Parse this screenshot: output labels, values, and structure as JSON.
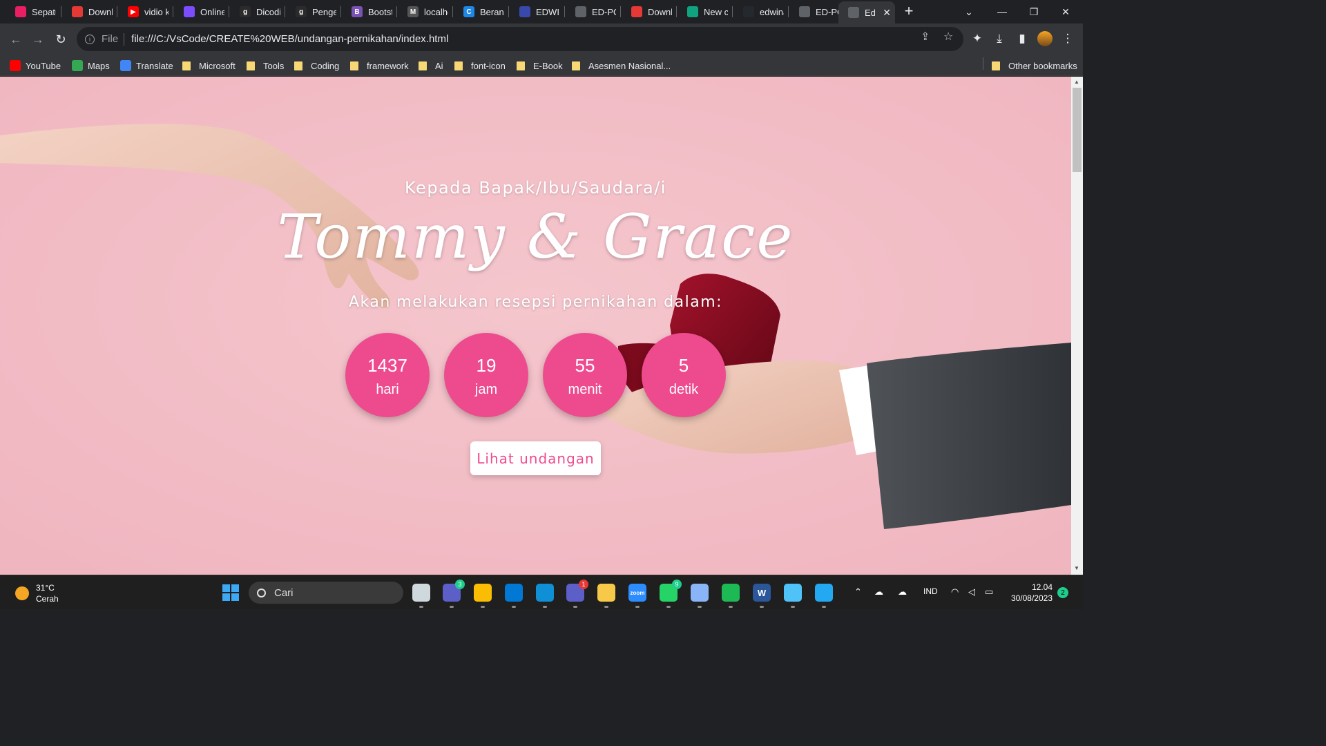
{
  "browser": {
    "tabs": [
      {
        "title": "Sepatu",
        "color": "#e91e63",
        "glyph": ""
      },
      {
        "title": "Downlo",
        "color": "#e53935",
        "glyph": ""
      },
      {
        "title": "vidio kl",
        "color": "#ff0000",
        "glyph": "▶"
      },
      {
        "title": "Online",
        "color": "#7c4dff",
        "glyph": ""
      },
      {
        "title": "Dicodin",
        "color": "#2b2b2b",
        "glyph": "g"
      },
      {
        "title": "Pengen",
        "color": "#2b2b2b",
        "glyph": "g"
      },
      {
        "title": "Bootstr",
        "color": "#7952b3",
        "glyph": "B"
      },
      {
        "title": "localho",
        "color": "#555555",
        "glyph": "M"
      },
      {
        "title": "Berand",
        "color": "#1e88e5",
        "glyph": "C"
      },
      {
        "title": "EDWIN",
        "color": "#3949ab",
        "glyph": ""
      },
      {
        "title": "ED-PO",
        "color": "#5f6368",
        "glyph": ""
      },
      {
        "title": "Downlo",
        "color": "#e53935",
        "glyph": ""
      },
      {
        "title": "New ch",
        "color": "#10a37f",
        "glyph": ""
      },
      {
        "title": "edwina",
        "color": "#24292e",
        "glyph": ""
      },
      {
        "title": "ED-PO",
        "color": "#5f6368",
        "glyph": ""
      },
      {
        "title": "Edw",
        "color": "#5f6368",
        "glyph": "",
        "active": true
      }
    ],
    "new_tab_label": "+",
    "url_scheme": "File",
    "url": "file:///C:/VsCode/CREATE%20WEB/undangan-pernikahan/index.html",
    "bookmarks": [
      {
        "label": "YouTube",
        "type": "site",
        "color": "#ff0000"
      },
      {
        "label": "Maps",
        "type": "site",
        "color": "#34a853"
      },
      {
        "label": "Translate",
        "type": "site",
        "color": "#4285f4"
      },
      {
        "label": "Microsoft",
        "type": "folder"
      },
      {
        "label": "Tools",
        "type": "folder"
      },
      {
        "label": "Coding",
        "type": "folder"
      },
      {
        "label": "framework",
        "type": "folder"
      },
      {
        "label": "Ai",
        "type": "folder"
      },
      {
        "label": "font-icon",
        "type": "folder"
      },
      {
        "label": "E-Book",
        "type": "folder"
      },
      {
        "label": "Asesmen Nasional...",
        "type": "folder"
      }
    ],
    "other_bookmarks": "Other bookmarks"
  },
  "page": {
    "greeting": "Kepada Bapak/Ibu/Saudara/i",
    "couple": "Tommy & Grace",
    "subtitle": "Akan melakukan resepsi pernikahan dalam:",
    "countdown": [
      {
        "value": "1437",
        "unit": "hari"
      },
      {
        "value": "19",
        "unit": "jam"
      },
      {
        "value": "55",
        "unit": "menit"
      },
      {
        "value": "5",
        "unit": "detik"
      }
    ],
    "cta_label": "Lihat undangan",
    "colors": {
      "background": "#f3bec6",
      "accent": "#ee4b8f",
      "button_bg": "#ffffff"
    }
  },
  "taskbar": {
    "weather_temp": "31°C",
    "weather_desc": "Cerah",
    "search_placeholder": "Cari",
    "apps": [
      {
        "name": "task-view",
        "color": "#cfd8dc"
      },
      {
        "name": "teams",
        "color": "#5b5fc7",
        "badge": "3"
      },
      {
        "name": "chrome",
        "color": "#fbbc04"
      },
      {
        "name": "store",
        "color": "#0078d4"
      },
      {
        "name": "edge",
        "color": "#0f8fd6"
      },
      {
        "name": "app-1",
        "color": "#5b5fc7",
        "badge": "1"
      },
      {
        "name": "explorer",
        "color": "#f7c948"
      },
      {
        "name": "zoom",
        "color": "#2d8cff",
        "label": "zoom"
      },
      {
        "name": "whatsapp",
        "color": "#25d366",
        "badge": "9"
      },
      {
        "name": "app-2",
        "color": "#8ab4f8"
      },
      {
        "name": "spotify",
        "color": "#1db954"
      },
      {
        "name": "word",
        "color": "#2b579a",
        "label": "W"
      },
      {
        "name": "app-3",
        "color": "#4fc3f7"
      },
      {
        "name": "vscode",
        "color": "#23a9f2"
      }
    ],
    "language": "IND",
    "time": "12.04",
    "date": "30/08/2023",
    "notifications": "2"
  }
}
